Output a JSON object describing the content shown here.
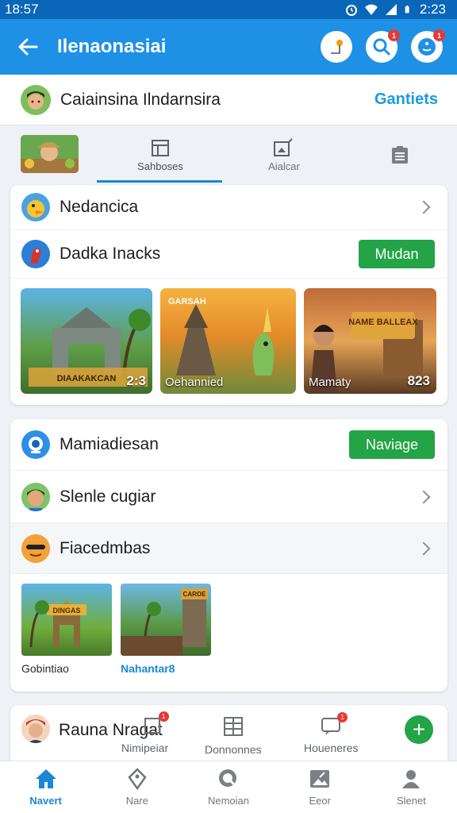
{
  "status_bar": {
    "time_left": "18:57",
    "time_right": "2:23"
  },
  "app_bar": {
    "title": "Ilenaonasiai",
    "badge_search": "1",
    "badge_profile": "1"
  },
  "header": {
    "name": "Caiainsina Ilndarnsira",
    "link": "Gantiets"
  },
  "tabs": [
    {
      "label": "Sahboses",
      "icon": "calendar-icon"
    },
    {
      "label": "Aialcar",
      "icon": "picture-icon"
    },
    {
      "label": "",
      "icon": "document-icon"
    }
  ],
  "card1": {
    "row1_label": "Nedancica",
    "row2_label": "Dadka Inacks",
    "row2_button": "Mudan",
    "thumbs": [
      {
        "caption": "",
        "number": "2:3",
        "banner": "DIAAKAKCAN"
      },
      {
        "caption": "Oehannied",
        "number": "",
        "banner": "GARSAH"
      },
      {
        "caption": "Mamaty",
        "number": "823",
        "banner": "NAME BALLEAX"
      }
    ]
  },
  "card2": {
    "row1_label": "Mamiadiesan",
    "row1_button": "Naviage",
    "row2_label": "Slenle cugiar",
    "row3_label": "Fiacedmbas",
    "thumbs": [
      {
        "caption": "Gobintiao",
        "banner": "DINGAS"
      },
      {
        "caption": "Nahantar8",
        "banner": "CAROE"
      }
    ]
  },
  "card3": {
    "name": "Rauna Nragat",
    "items": [
      {
        "label": "Nimipeiar",
        "badge": "1"
      },
      {
        "label": "Donnonnes",
        "badge": ""
      },
      {
        "label": "Houeneres",
        "badge": "1"
      }
    ],
    "fab": "+"
  },
  "bottom_nav": [
    {
      "label": "Navert",
      "icon": "home-icon",
      "active": true
    },
    {
      "label": "Nare",
      "icon": "tag-icon",
      "active": false
    },
    {
      "label": "Nemoian",
      "icon": "chat-search-icon",
      "active": false
    },
    {
      "label": "Eeor",
      "icon": "image-icon",
      "active": false
    },
    {
      "label": "Slenet",
      "icon": "person-icon",
      "active": false
    }
  ],
  "colors": {
    "primary": "#1e90e6",
    "status": "#0a66b8",
    "accent_green": "#22a447",
    "link": "#1a9be0"
  }
}
